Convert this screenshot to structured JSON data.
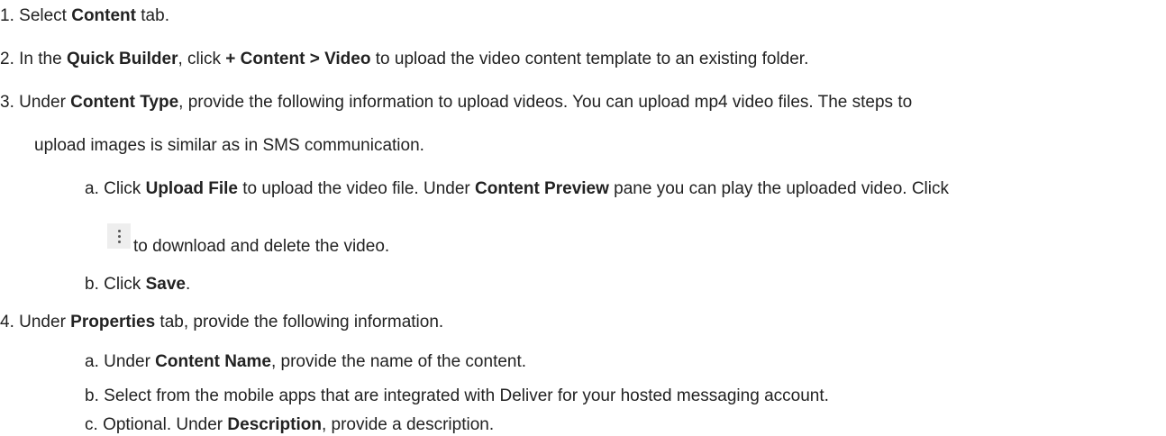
{
  "steps": [
    {
      "num": "1.",
      "t1": "Select ",
      "b1": "Content",
      "t2": " tab."
    },
    {
      "num": "2.",
      "t1": "In the ",
      "b1": "Quick Builder",
      "t2": ", click ",
      "b2": "+ Content > Video",
      "t3": " to upload the video content template to an existing folder."
    },
    {
      "num": "3.",
      "t1": "Under ",
      "b1": "Content Type",
      "t2": ", provide the following information to upload videos. You can upload mp4 video files. The steps to",
      "cont": "upload images is similar as in SMS communication.",
      "substeps": [
        {
          "letter": "a.",
          "t1": "Click ",
          "b1": "Upload File",
          "t2": " to upload the video file. Under ",
          "b2": "Content Preview",
          "t3": " pane you can play the uploaded video. Click",
          "cont": "to download and delete the video."
        },
        {
          "letter": "b.",
          "t1": "Click ",
          "b1": "Save",
          "t2": "."
        }
      ]
    },
    {
      "num": "4.",
      "t1": "Under ",
      "b1": "Properties",
      "t2": " tab, provide the following information.",
      "substeps": [
        {
          "letter": "a.",
          "t1": "Under ",
          "b1": "Content Name",
          "t2": ", provide the name of the content."
        },
        {
          "letter": "b.",
          "t1": "Select from the mobile apps that are integrated with Deliver for your hosted messaging account."
        },
        {
          "letter": "c.",
          "t1": "Optional. Under ",
          "b1": "Description",
          "t2": ", provide a description."
        }
      ]
    }
  ],
  "icons": {
    "kebab": "more-vertical-icon"
  }
}
